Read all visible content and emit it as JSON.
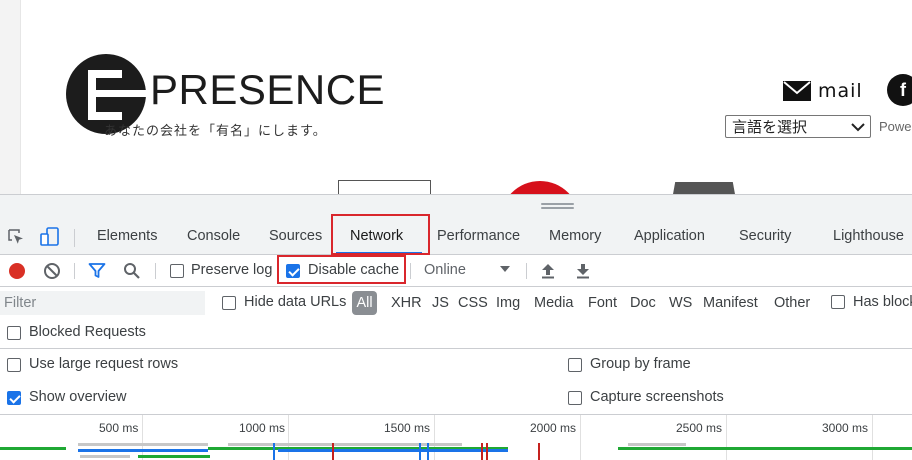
{
  "website": {
    "logo_text": "PRESENCE",
    "logo_letter": "E",
    "tagline": "あなたの会社を「有名」にします。",
    "mail_label": "mail",
    "facebook_letter": "f",
    "language_select": "言語を選択",
    "powered_label": "Powe"
  },
  "devtools": {
    "tabs": [
      "Elements",
      "Console",
      "Sources",
      "Network",
      "Performance",
      "Memory",
      "Application",
      "Security",
      "Lighthouse"
    ],
    "active_tab": "Network",
    "toolbar": {
      "preserve_log_label": "Preserve log",
      "preserve_log_checked": false,
      "disable_cache_label": "Disable cache",
      "disable_cache_checked": true,
      "throttling_value": "Online"
    },
    "filterbar": {
      "filter_placeholder": "Filter",
      "hide_data_urls_label": "Hide data URLs",
      "types": [
        "All",
        "XHR",
        "JS",
        "CSS",
        "Img",
        "Media",
        "Font",
        "Doc",
        "WS",
        "Manifest",
        "Other"
      ],
      "selected_type": "All",
      "has_blocked_label": "Has block"
    },
    "blocked_requests_label": "Blocked Requests",
    "settings": {
      "large_rows_label": "Use large request rows",
      "large_rows_checked": false,
      "show_overview_label": "Show overview",
      "show_overview_checked": true,
      "group_by_frame_label": "Group by frame",
      "group_by_frame_checked": false,
      "capture_screenshots_label": "Capture screenshots",
      "capture_screenshots_checked": false
    },
    "overview": {
      "ticks": [
        "500 ms",
        "1000 ms",
        "1500 ms",
        "2000 ms",
        "2500 ms",
        "3000 ms"
      ]
    }
  },
  "colors": {
    "accent": "#1a73e8",
    "record": "#d93025",
    "highlight": "#d9262c"
  }
}
